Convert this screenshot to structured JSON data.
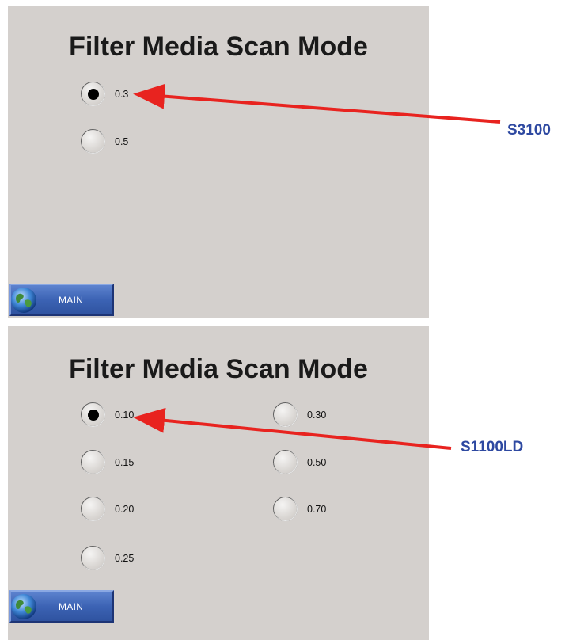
{
  "screens": [
    {
      "title": "Filter Media Scan Mode",
      "options": [
        {
          "label": "0.3",
          "selected": true
        },
        {
          "label": "0.5",
          "selected": false
        }
      ],
      "main_button": "MAIN",
      "callout": "S3100"
    },
    {
      "title": "Filter Media Scan Mode",
      "options": [
        {
          "label": "0.10",
          "selected": true
        },
        {
          "label": "0.15",
          "selected": false
        },
        {
          "label": "0.20",
          "selected": false
        },
        {
          "label": "0.25",
          "selected": false
        },
        {
          "label": "0.30",
          "selected": false
        },
        {
          "label": "0.50",
          "selected": false
        },
        {
          "label": "0.70",
          "selected": false
        }
      ],
      "main_button": "MAIN",
      "callout": "S1100LD"
    }
  ],
  "colors": {
    "panel_background": "#d4d0cd",
    "callout_text": "#2e49a1",
    "arrow": "#e8231f",
    "button": "#3c63b4"
  },
  "icons": {
    "main_button": "globe-icon"
  }
}
